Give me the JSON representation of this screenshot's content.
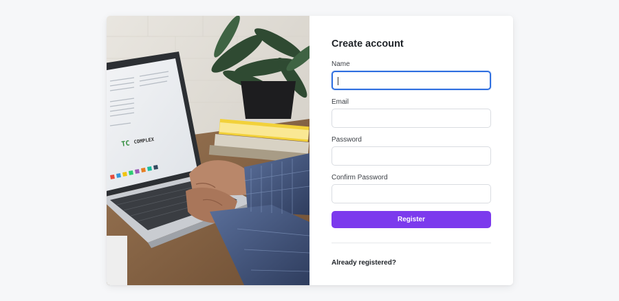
{
  "form": {
    "title": "Create account",
    "fields": [
      {
        "label": "Name",
        "value": "",
        "focused": true
      },
      {
        "label": "Email",
        "value": ""
      },
      {
        "label": "Password",
        "value": ""
      },
      {
        "label": "Confirm Password",
        "value": ""
      }
    ],
    "register_label": "Register",
    "already_registered_label": "Already registered?"
  },
  "photo": {
    "screen_text": "TC",
    "screen_text_2": "COMPLEX"
  },
  "colors": {
    "accent": "#7c3aed",
    "focus_ring": "#2f6fe0",
    "background": "#f6f7f9"
  }
}
